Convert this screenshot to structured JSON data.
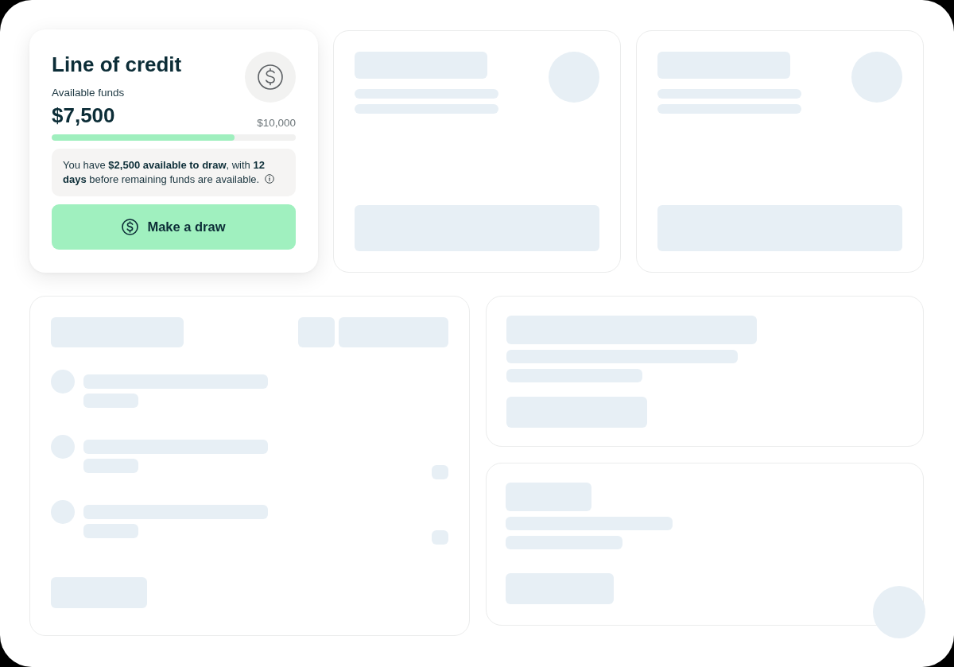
{
  "credit_card": {
    "title": "Line of credit",
    "funds_label": "Available funds",
    "available_amount": "$7,500",
    "limit_amount": "$10,000",
    "usage_bar": {
      "level": 0.75
    },
    "notice": "You have **$2,500 available to draw**, with **12 days** before remaining funds are available.",
    "draw_button": {
      "label": "Make a draw"
    }
  }
}
